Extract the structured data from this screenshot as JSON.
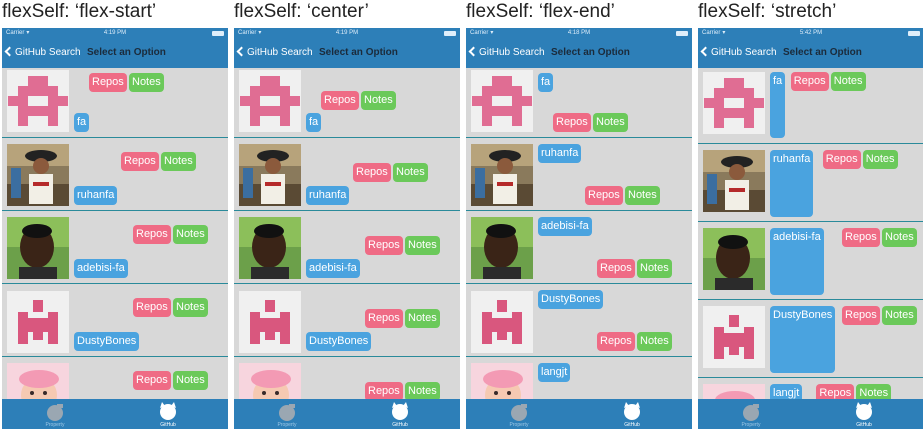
{
  "panels": [
    {
      "heading": "flexSelf: ‘flex-start’",
      "time": "4:19 PM"
    },
    {
      "heading": "flexSelf: ‘center’",
      "time": "4:19 PM"
    },
    {
      "heading": "flexSelf: ‘flex-end’",
      "time": "4:18 PM"
    },
    {
      "heading": "flexSelf: ‘stretch’",
      "time": "5:42 PM"
    }
  ],
  "statusbar": {
    "carrier": "Carrier",
    "wifi_icon": "wifi-icon",
    "battery_icon": "battery-icon"
  },
  "navbar": {
    "back_label": "GitHub Search",
    "title": "Select an Option"
  },
  "users": [
    {
      "login": "fa",
      "avatar": "pink-identicon-1"
    },
    {
      "login": "ruhanfa",
      "avatar": "photo-costume"
    },
    {
      "login": "adebisi-fa",
      "avatar": "photo-portrait"
    },
    {
      "login": "DustyBones",
      "avatar": "pink-identicon-2"
    },
    {
      "login": "langjt",
      "avatar": "photo-baby"
    }
  ],
  "buttons": {
    "repos": "Repos",
    "notes": "Notes"
  },
  "tabs": [
    {
      "label": "Property",
      "icon": "property-icon",
      "active": false
    },
    {
      "label": "GitHub",
      "icon": "github-octocat-icon",
      "active": true
    }
  ],
  "colors": {
    "nav": "#2d7fb8",
    "list_bg": "#d8d8d8",
    "login": "#4aa3df",
    "repos": "#ef6b85",
    "notes": "#6bc95a",
    "separator": "#2a8a9a"
  }
}
